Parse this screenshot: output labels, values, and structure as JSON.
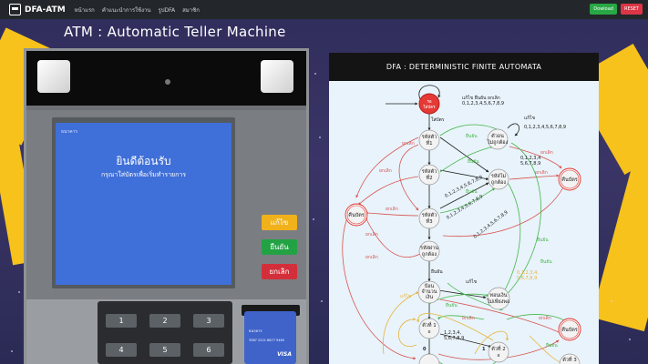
{
  "nav": {
    "brand": "DFA-ATM",
    "links": [
      "หน้าแรก",
      "คำแนะนำการใช้งาน",
      "รูปDFA",
      "สมาชิก"
    ],
    "download_label": "Dowload",
    "reset_label": "RESET"
  },
  "title": "ATM : Automatic Teller Machine",
  "atm": {
    "screen": {
      "bank": "ธนาคาร",
      "welcome": "ยินดีต้อนรับ",
      "subtitle": "กรุณาใส่บัตรเพื่อเริ่มทำรายการ"
    },
    "buttons": {
      "edit": "แก้ไข",
      "confirm": "ยืนยัน",
      "cancel": "ยกเลิก"
    },
    "keys": [
      "1",
      "2",
      "3",
      "4",
      "5",
      "6"
    ],
    "card": {
      "bank": "ธนาคาร",
      "number": "3587 2221 8877 9465",
      "brand": "VISA"
    }
  },
  "dfa": {
    "header": "DFA : DETERMINISTIC FINITE AUTOMATA",
    "states": {
      "start": [
        "รอ",
        "ใส่บัตร"
      ],
      "pin1": [
        "รหัสตัว",
        "ที่1"
      ],
      "pin_wrong": [
        "ตัวอน",
        "ไม่ถูกต้อง"
      ],
      "pin2": [
        "รหัสตัว",
        "ที่2"
      ],
      "pin_ok": [
        "รหัสไม่",
        "ถูกต้อง"
      ],
      "eject_right": "คืนบัตร",
      "pin3": [
        "รหัสตัว",
        "ที่3"
      ],
      "eject_left": "คืนบัตร",
      "pin_pass": [
        "รหัสผ่าน",
        "ถูกต้อง"
      ],
      "amount": [
        "ป้อน",
        "จำนวน",
        "เงิน"
      ],
      "withdraw": [
        "ทอนเงิน",
        "ไม่เพียงพอ"
      ],
      "eject_bottom": "คืนบัตร",
      "digit1": [
        "ตัวที่ 1",
        "x"
      ],
      "digit2": [
        "ตัวที่ 2",
        "x"
      ],
      "digit3": [
        "ตัวที่ 3",
        "x"
      ]
    },
    "labels": {
      "insert_card": "ใส่บัตร",
      "edit": "แก้ไข",
      "confirm": "ยืนยัน",
      "cancel": "ยกเลิก",
      "digits_all": "0,1,2,3,4,5,6,7,8,9",
      "digits_rest": "1,2,3,4,5,6,7,8,9",
      "digits_a": "0,1,2,3,4",
      "digits_b": "5,6,7,8,9",
      "digits_c": "0,1,2,3,4,",
      "digits_d": "5,6,7,8,9",
      "digits_e": "1,2,3,4,",
      "digits_f": "5,6,7,8,9",
      "edit_confirm_cancel": "แก้ไข ยืนยัน ยกเลิก",
      "zero": "0",
      "one": "1",
      "diag1": "0,1,2,3,4,5,6,7,8,9",
      "diag2": "0,1,2,3,4,5,6,7,8,9",
      "diag3": "0,1,2,3,4,5,6,7,8,9"
    }
  }
}
